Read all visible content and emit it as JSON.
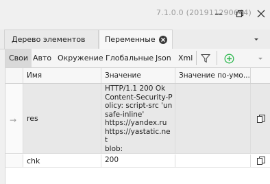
{
  "window": {
    "version": "7.1.0.0 (201911290644)",
    "minimize_icon": "minimize-icon",
    "maximize_icon": "restore-icon",
    "close_icon": "close-icon"
  },
  "tabs": [
    {
      "label": "Дерево элементов",
      "active": false
    },
    {
      "label": "Переменные",
      "active": true,
      "closable": true
    }
  ],
  "filters": {
    "items": [
      {
        "label": "Свои",
        "active": true
      },
      {
        "label": "Авто",
        "active": false
      },
      {
        "label": "Окружение",
        "active": false
      },
      {
        "label": "Глобальные",
        "active": false
      },
      {
        "label": "Json",
        "active": false
      },
      {
        "label": "Xml",
        "active": false
      }
    ],
    "filter_icon": "filter-icon",
    "add_icon": "add-circle-icon",
    "add_color": "#2eb84f",
    "more_icon": "chevron-down-icon"
  },
  "table": {
    "columns": [
      "Имя",
      "Значение",
      "Значение по-умо..."
    ],
    "rows": [
      {
        "selected": true,
        "arrow": "→",
        "name": "res",
        "value": "HTTP/1.1 200 Ok\nContent-Security-Policy: script-src 'unsafe-inline'\nhttps://yandex.ru\nhttps://yastatic.net\nblob:",
        "default": ""
      },
      {
        "selected": false,
        "arrow": "",
        "name": "chk",
        "value": "200",
        "default": ""
      }
    ],
    "copy_icon": "copy-icon"
  }
}
